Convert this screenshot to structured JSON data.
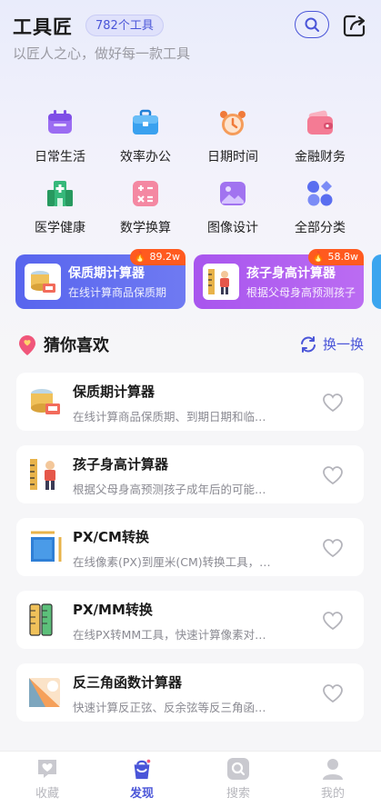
{
  "header": {
    "title": "工具匠",
    "tool_count": "782个工具",
    "subtitle": "以匠人之心，做好每一款工具",
    "search_icon": "search-icon",
    "share_icon": "share-icon"
  },
  "categories": [
    {
      "label": "日常生活",
      "icon": "calendar-icon",
      "color": "#9b6cf2"
    },
    {
      "label": "效率办公",
      "icon": "briefcase-icon",
      "color": "#3aa1ef"
    },
    {
      "label": "日期时间",
      "icon": "alarm-clock-icon",
      "color": "#f59c5a"
    },
    {
      "label": "金融财务",
      "icon": "wallet-icon",
      "color": "#f47b94"
    },
    {
      "label": "医学健康",
      "icon": "hospital-icon",
      "color": "#36b87a"
    },
    {
      "label": "数学换算",
      "icon": "calculator-icon",
      "color": "#f488a2"
    },
    {
      "label": "图像设计",
      "icon": "image-icon",
      "color": "#a173f0"
    },
    {
      "label": "全部分类",
      "icon": "grid-icon",
      "color": "#5a6ef0"
    }
  ],
  "hot_tools": [
    {
      "title": "保质期计算器",
      "desc": "在线计算商品保质期",
      "badge": "89.2w",
      "color": "#5b68f0"
    },
    {
      "title": "孩子身高计算器",
      "desc": "根据父母身高预测孩子",
      "badge": "58.8w",
      "color": "#b15cf0"
    }
  ],
  "section": {
    "title": "猜你喜欢",
    "refresh_label": "换一换"
  },
  "tools": [
    {
      "name": "保质期计算器",
      "desc": "在线计算商品保质期、到期日期和临…",
      "icon": "food-can-icon"
    },
    {
      "name": "孩子身高计算器",
      "desc": "根据父母身高预测孩子成年后的可能…",
      "icon": "height-ruler-icon"
    },
    {
      "name": "PX/CM转换",
      "desc": "在线像素(PX)到厘米(CM)转换工具，…",
      "icon": "ruler-cm-icon"
    },
    {
      "name": "PX/MM转换",
      "desc": "在线PX转MM工具，快速计算像素对…",
      "icon": "ruler-mm-icon"
    },
    {
      "name": "反三角函数计算器",
      "desc": "快速计算反正弦、反余弦等反三角函…",
      "icon": "trig-chart-icon"
    }
  ],
  "tabbar": [
    {
      "label": "收藏",
      "icon": "heart-chat-icon",
      "active": false
    },
    {
      "label": "发现",
      "icon": "discover-bag-icon",
      "active": true
    },
    {
      "label": "搜索",
      "icon": "search-icon",
      "active": false
    },
    {
      "label": "我的",
      "icon": "user-icon",
      "active": false
    }
  ],
  "colors": {
    "accent": "#4a55d8",
    "hot_badge": "#ff5a1f"
  }
}
